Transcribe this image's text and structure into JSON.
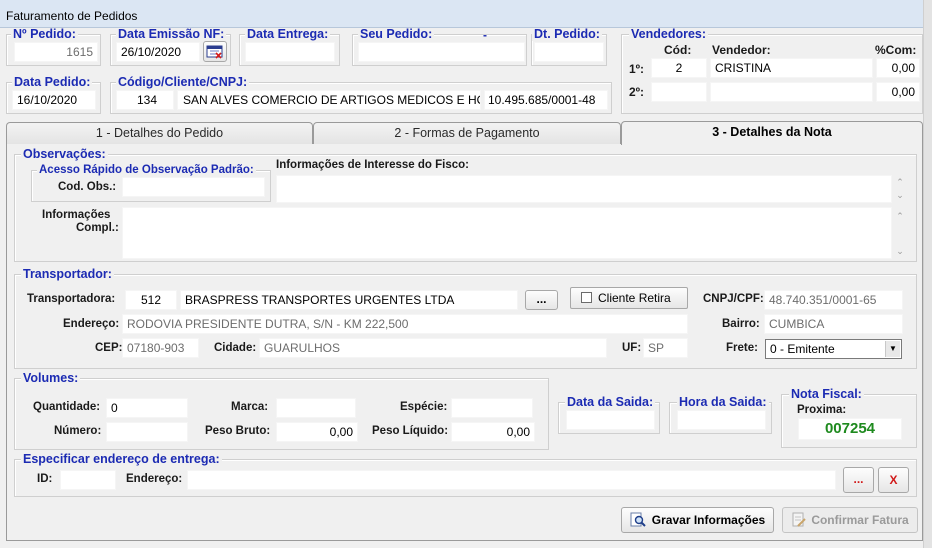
{
  "window": {
    "title": "Faturamento de Pedidos"
  },
  "header": {
    "num_pedido_label": "Nº Pedido:",
    "num_pedido": "1615",
    "data_emissao_label": "Data Emissão NF:",
    "data_emissao": "26/10/2020",
    "data_entrega_label": "Data Entrega:",
    "data_entrega": "",
    "seu_pedido_label": "Seu Pedido:",
    "seu_pedido_dash": "-",
    "seu_pedido": "",
    "dt_pedido_label": "Dt. Pedido:",
    "dt_pedido": "",
    "data_pedido_label": "Data Pedido:",
    "data_pedido": "16/10/2020",
    "cliente_label": "Código/Cliente/CNPJ:",
    "cliente_codigo": "134",
    "cliente_nome": "SAN ALVES COMERCIO DE ARTIGOS MEDICOS E HOS",
    "cliente_cnpj": "10.495.685/0001-48"
  },
  "vendedores": {
    "label": "Vendedores:",
    "col_cod": "Cód:",
    "col_vendedor": "Vendedor:",
    "col_com": "%Com:",
    "rows": [
      {
        "pos": "1º:",
        "cod": "2",
        "nome": "CRISTINA",
        "com": "0,00"
      },
      {
        "pos": "2º:",
        "cod": "",
        "nome": "",
        "com": "0,00"
      }
    ]
  },
  "tabs": [
    {
      "label": "1 - Detalhes do Pedido"
    },
    {
      "label": "2 - Formas de Pagamento"
    },
    {
      "label": "3 - Detalhes da Nota"
    }
  ],
  "observacoes": {
    "label": "Observações:",
    "acesso_label": "Acesso Rápido de Observação Padrão:",
    "cod_obs_label": "Cod.  Obs.:",
    "cod_obs": "",
    "fisco_label": "Informações de Interesse do Fisco:",
    "fisco": "",
    "compl_label_1": "Informações",
    "compl_label_2": "Compl.:",
    "compl": ""
  },
  "transportador": {
    "label": "Transportador:",
    "transportadora_label": "Transportadora:",
    "codigo": "512",
    "nome": "BRASPRESS TRANSPORTES URGENTES LTDA",
    "browse_label": "...",
    "cliente_retira_label": "Cliente Retira",
    "cnpj_label": "CNPJ/CPF:",
    "cnpj": "48.740.351/0001-65",
    "endereco_label": "Endereço:",
    "endereco": "RODOVIA PRESIDENTE DUTRA, S/N - KM 222,500",
    "bairro_label": "Bairro:",
    "bairro": "CUMBICA",
    "cep_label": "CEP:",
    "cep": "07180-903",
    "cidade_label": "Cidade:",
    "cidade": "GUARULHOS",
    "uf_label": "UF:",
    "uf": "SP",
    "frete_label": "Frete:",
    "frete": "0 - Emitente"
  },
  "volumes": {
    "label": "Volumes:",
    "quantidade_label": "Quantidade:",
    "quantidade": "0",
    "marca_label": "Marca:",
    "marca": "",
    "especie_label": "Espécie:",
    "especie": "",
    "numero_label": "Número:",
    "numero": "",
    "peso_bruto_label": "Peso Bruto:",
    "peso_bruto": "0,00",
    "peso_liquido_label": "Peso Líquido:",
    "peso_liquido": "0,00"
  },
  "saida": {
    "data_label": "Data da Saida:",
    "data": "",
    "hora_label": "Hora da Saida:",
    "hora": ""
  },
  "nota_fiscal": {
    "label": "Nota Fiscal:",
    "proxima_label": "Proxima:",
    "proxima": "007254",
    "proxima_color": "#1e8a1e"
  },
  "entrega": {
    "label": "Especificar endereço de entrega:",
    "id_label": "ID:",
    "id": "",
    "endereco_label": "Endereço:",
    "endereco": "",
    "browse_label": "...",
    "clear_label": "X"
  },
  "actions": {
    "gravar_label": "Gravar Informações",
    "confirmar_label": "Confirmar Fatura"
  },
  "colors": {
    "label_blue": "#1c2bb3",
    "danger_red": "#d11a1a"
  }
}
